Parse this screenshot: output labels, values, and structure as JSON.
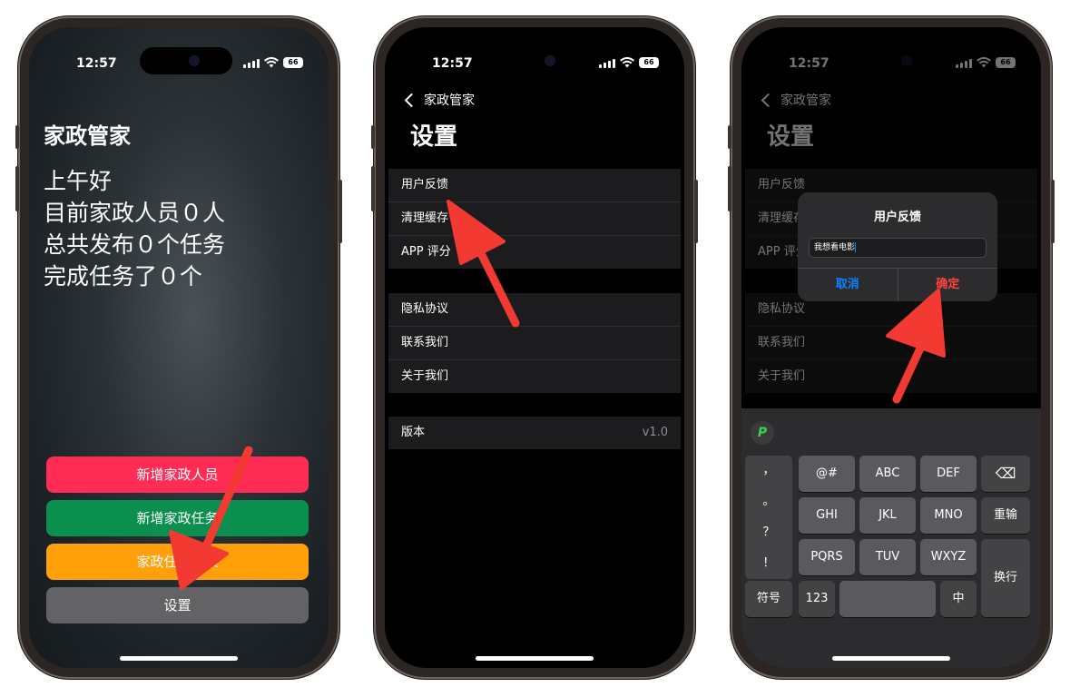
{
  "status": {
    "time": "12:57",
    "battery": "66"
  },
  "phone1": {
    "app_title": "家政管家",
    "greeting_lines": [
      "上午好",
      "目前家政人员０人",
      "总共发布０个任务",
      "完成任务了０个"
    ],
    "buttons": [
      {
        "label": "新增家政人员",
        "color": "#ff2d55"
      },
      {
        "label": "新增家政任务",
        "color": "#0a8f4f"
      },
      {
        "label": "家政任务列表",
        "color": "#ff9f0a"
      },
      {
        "label": "设置",
        "color": "#636366"
      }
    ]
  },
  "settings": {
    "back_label": "家政管家",
    "title": "设置",
    "group1": [
      "用户反馈",
      "清理缓存",
      "APP 评分"
    ],
    "group2": [
      "隐私协议",
      "联系我们",
      "关于我们"
    ],
    "version_label": "版本",
    "version_value": "v1.0"
  },
  "dialog": {
    "title": "用户反馈",
    "input_value": "我想看电影",
    "cancel": "取消",
    "confirm": "确定"
  },
  "keyboard": {
    "punctuation": [
      "，",
      "。",
      "？",
      "！"
    ],
    "row1": [
      "@#",
      "ABC",
      "DEF"
    ],
    "row2": [
      "GHI",
      "JKL",
      "MNO"
    ],
    "row3": [
      "PQRS",
      "TUV",
      "WXYZ"
    ],
    "delete": "⌫",
    "reinput": "重输",
    "newline": "换行",
    "symbols": "符号",
    "numbers": "123",
    "lang": "中"
  },
  "colors": {
    "arrow": "#f23a33"
  }
}
